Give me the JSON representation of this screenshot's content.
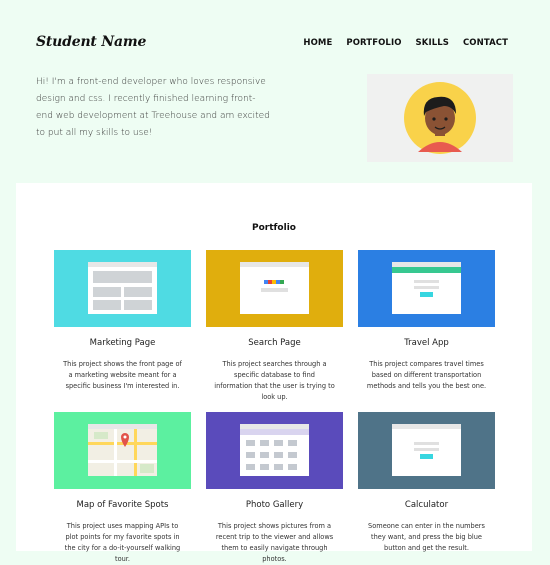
{
  "header": {
    "brand": "Student Name",
    "nav": [
      "HOME",
      "PORTFOLIO",
      "SKILLS",
      "CONTACT"
    ],
    "intro": "Hi! I'm a front-end developer who loves responsive design and css. I recently finished learning front-end web development at Treehouse and am excited to put all my skills to use!"
  },
  "portfolio": {
    "title": "Portfolio",
    "projects": [
      {
        "title": "Marketing Page",
        "description": "This project shows the front page of a marketing website meant for a specific business I'm interested in.",
        "color": "#4fdbe3"
      },
      {
        "title": "Search Page",
        "description": "This project searches through a specific database to find information that the user is trying to look up.",
        "color": "#e0ae0d"
      },
      {
        "title": "Travel App",
        "description": "This project compares travel times based on different transportation methods and tells you the best one.",
        "color": "#2b7fe3"
      },
      {
        "title": "Map of Favorite Spots",
        "description": "This project uses mapping APIs to plot points for my favorite spots in the city for a do-it-yourself walking tour.",
        "color": "#5cf0a0"
      },
      {
        "title": "Photo Gallery",
        "description": "This project shows pictures from a recent trip to the viewer and allows them to easily navigate through photos.",
        "color": "#5a4bbb"
      },
      {
        "title": "Calculator",
        "description": "Someone can enter in the numbers they want, and press the big blue button and get the result.",
        "color": "#4f7388"
      }
    ]
  }
}
